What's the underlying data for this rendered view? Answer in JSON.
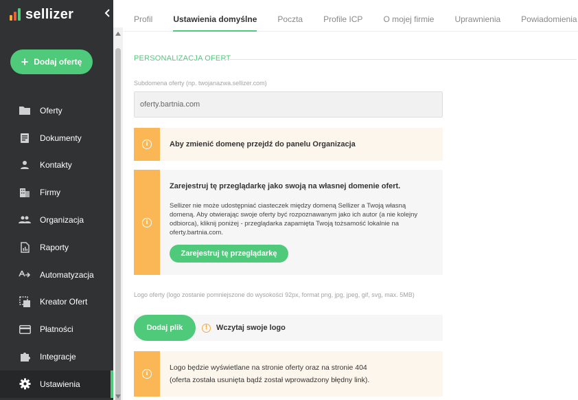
{
  "app": {
    "name": "sellizer",
    "brand_colors": [
      "#f7a93b",
      "#ef5a3c",
      "#4fc97a"
    ]
  },
  "sidebar": {
    "collapse_icon": "chevron-left-icon",
    "add_offer_label": "Dodaj ofertę",
    "items": [
      {
        "label": "Oferty",
        "icon": "folder-icon"
      },
      {
        "label": "Dokumenty",
        "icon": "document-icon"
      },
      {
        "label": "Kontakty",
        "icon": "person-icon"
      },
      {
        "label": "Firmy",
        "icon": "building-icon"
      },
      {
        "label": "Organizacja",
        "icon": "people-icon"
      },
      {
        "label": "Raporty",
        "icon": "report-icon"
      },
      {
        "label": "Automatyzacja",
        "icon": "automation-icon"
      },
      {
        "label": "Kreator Ofert",
        "icon": "wizard-icon"
      },
      {
        "label": "Płatności",
        "icon": "credit-card-icon"
      },
      {
        "label": "Integracje",
        "icon": "puzzle-icon"
      },
      {
        "label": "Ustawienia",
        "icon": "gear-icon",
        "active": true
      }
    ]
  },
  "tabs": [
    {
      "label": "Profil"
    },
    {
      "label": "Ustawienia domyślne",
      "active": true
    },
    {
      "label": "Poczta"
    },
    {
      "label": "Profile ICP"
    },
    {
      "label": "O mojej firmie"
    },
    {
      "label": "Uprawnienia"
    },
    {
      "label": "Powiadomienia"
    }
  ],
  "main": {
    "section_title": "PERSONALIZACJA OFERT",
    "subdomain": {
      "label": "Subdomena oferty (np. twojanazwa.sellizer.com)",
      "value": "oferty.bartnia.com"
    },
    "notice_domain": "Aby zmienić domenę przejdź do panelu Organizacja",
    "notice_register": {
      "title": "Zarejestruj tę przeglądarkę jako swoją na własnej domenie ofert.",
      "text": "Sellizer nie może udostępniać ciasteczek między domeną Sellizer a Twoją własną domeną. Aby otwierając swoje oferty być rozpoznawanym jako ich autor (a nie kolejny odbiorca), kliknij poniżej - przeglądarka zapamięta Twoją tożsamość lokalnie na oferty.bartnia.com.",
      "button": "Zarejestruj tę przeglądarkę"
    },
    "logo": {
      "label": "Logo oferty (logo zostanie pomniejszone do wysokości 92px, format png, jpg, jpeg, gif, svg, max. 5MB)",
      "button": "Dodaj plik",
      "hint": "Wczytaj swoje logo"
    },
    "notice_logo": {
      "line1": "Logo będzie wyświetlane na stronie oferty oraz na stronie 404",
      "line2": "(oferta została usunięta bądź został wprowadzony błędny link)."
    }
  }
}
